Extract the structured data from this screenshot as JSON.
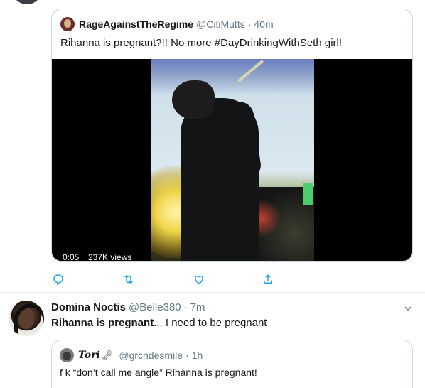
{
  "quoted_tweet": {
    "display_name": "RageAgainstTheRegime",
    "handle": "@CitiMutts",
    "separator": "·",
    "time": "40m",
    "text": "Rihanna is pregnant?!! No more #DayDrinkingWithSeth girl!",
    "video": {
      "duration": "0:05",
      "views": "237K views"
    }
  },
  "actions": [
    {
      "name": "reply-icon",
      "color": "#1da1f2"
    },
    {
      "name": "retweet-icon",
      "color": "#1da1f2"
    },
    {
      "name": "like-icon",
      "color": "#1da1f2"
    },
    {
      "name": "share-icon",
      "color": "#1da1f2"
    }
  ],
  "tweet": {
    "display_name": "Domina Noctis",
    "handle": "@Belle380",
    "separator": "·",
    "time": "7m",
    "text_bold": "Rihanna is pregnant",
    "text_rest": "... I need to be pregnant"
  },
  "nested_quote": {
    "display_name": "Tori",
    "name_emoji": "🗝",
    "handle": "@grcndesmile",
    "separator": "·",
    "time": "1h",
    "text": "f  k “don’t call me angle” Rihanna is pregnant!"
  },
  "colors": {
    "accent": "#1da1f2",
    "muted_text": "#657786",
    "border": "#ccd6dd"
  }
}
